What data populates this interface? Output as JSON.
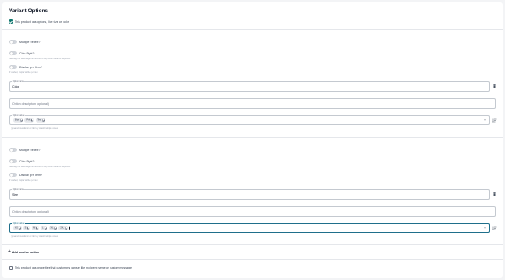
{
  "title": "Variant Options",
  "has_options": {
    "label": "This product has options, like size or color",
    "checked": true
  },
  "options": [
    {
      "multiple_select_label": "Multiple Select?",
      "chip_style_label": "Chip Style?",
      "chip_style_helper": "Selecting this will change the selector to chip style instead of dropdown",
      "display_per_item_label": "Display per Item?",
      "display_per_item_helper": "If enabled, display will be per item",
      "name_label": "Option name",
      "name_value": "Color",
      "description_placeholder": "Option description (optional)",
      "values_label": "Option values",
      "values": [
        "Blue",
        "Pink",
        "Teal"
      ],
      "values_helper": "Type and press Enter or Tab key to add multiple values"
    },
    {
      "multiple_select_label": "Multiple Select?",
      "chip_style_label": "Chip Style?",
      "chip_style_helper": "Selecting this will change the selector to chip style instead of dropdown",
      "display_per_item_label": "Display per Item?",
      "display_per_item_helper": "If enabled, display will be per item",
      "name_label": "Option name",
      "name_value": "Size",
      "description_placeholder": "Option description (optional)",
      "values_label": "Option values",
      "values": [
        "XS",
        "S",
        "M",
        "L",
        "XL",
        "2XL"
      ],
      "values_helper": "Type and press Enter or Tab key to add multiple values"
    }
  ],
  "add_option_label": "Add another option",
  "has_properties": {
    "label": "This product has properties that customers can set like recipient name or custom message",
    "checked": false
  },
  "icons": {
    "trash": "trash-icon",
    "sort": "sort-icon",
    "plus": "plus-icon",
    "check": "check-icon",
    "close": "close-icon",
    "caret": "chevron-down-icon"
  },
  "colors": {
    "accent": "#0f766e",
    "focus_border": "#1f6f8b",
    "chip_bg": "#e5e7eb"
  }
}
